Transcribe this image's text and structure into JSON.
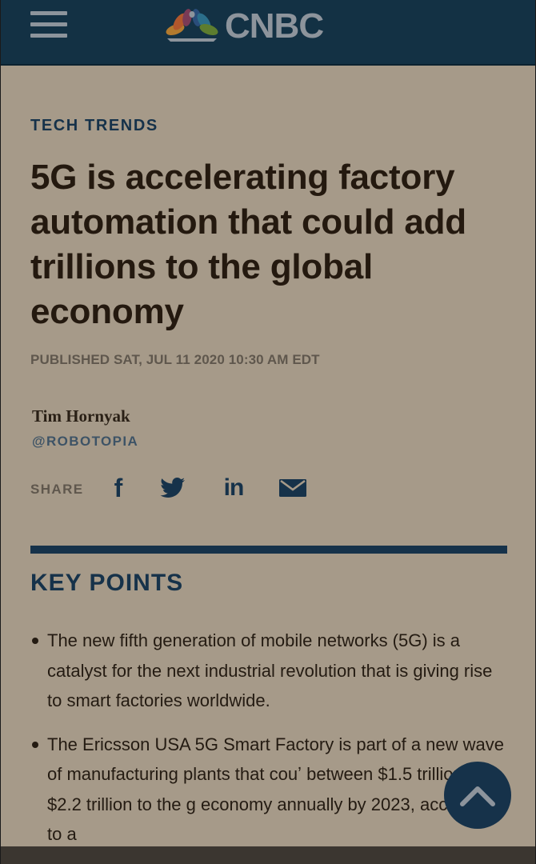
{
  "header": {
    "logo_text": "CNBC",
    "menu_icon": "hamburger-menu-icon",
    "brand_color": "#133144"
  },
  "article": {
    "section": "TECH TRENDS",
    "headline": "5G is accelerating factory automation that could add trillions to the global economy",
    "published": "PUBLISHED SAT, JUL 11 2020 10:30 AM EDT",
    "author": "Tim Hornyak",
    "handle": "@ROBOTOPIA",
    "share_label": "SHARE",
    "share_icons": [
      "facebook-icon",
      "twitter-icon",
      "linkedin-icon",
      "email-icon"
    ]
  },
  "key_points": {
    "title": "KEY POINTS",
    "items": [
      "The new fifth generation of mobile networks (5G) is a catalyst for the next industrial revolution that is giving rise to smart factories worldwide.",
      "The Ericsson USA 5G Smart Factory is part of a new wave of manufacturing plants that couʼ between $1.5 trillion to $2.2 trillion to the g economy annually by 2023, according to a"
    ]
  },
  "controls": {
    "back_to_top_icon": "chevron-up-icon"
  },
  "colors": {
    "accent": "#16324a",
    "page_background": "#a69a89",
    "headline_text": "#24190f"
  }
}
